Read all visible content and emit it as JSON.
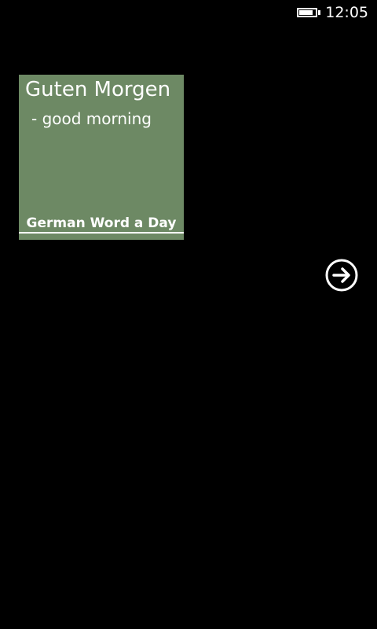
{
  "status_bar": {
    "time": "12:05",
    "battery_level": 0.85,
    "battery_icon": "battery-icon"
  },
  "tile": {
    "word": "Guten Morgen",
    "translation": " - good morning",
    "title": "German Word a Day",
    "background_color": "#6d8964"
  },
  "next_button": {
    "icon": "arrow-right-circle-icon"
  }
}
